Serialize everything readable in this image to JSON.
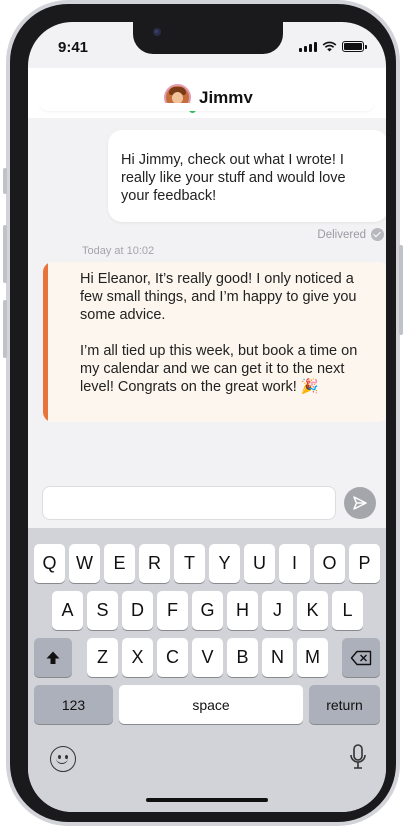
{
  "status_bar": {
    "time": "9:41"
  },
  "header": {
    "contact_name": "Jimmy"
  },
  "messages": {
    "outgoing": {
      "text": "Hi Jimmy, check out what I wrote! I really like your stuff and would love your feedback!",
      "status": "Delivered"
    },
    "timestamp": "Today at 10:02",
    "incoming": {
      "paragraph_1": "Hi Eleanor, It’s really good! I only noticed a few small things, and I’m happy to give you some advice.",
      "paragraph_2": "I’m all tied up this week, but book a time on my calendar and we can get it to the next level! Congrats on the great work! 🎉"
    }
  },
  "composer": {
    "value": "",
    "send_icon": "send-icon"
  },
  "keyboard": {
    "row1": [
      "Q",
      "W",
      "E",
      "R",
      "T",
      "Y",
      "U",
      "I",
      "O",
      "P"
    ],
    "row2": [
      "A",
      "S",
      "D",
      "F",
      "G",
      "H",
      "J",
      "K",
      "L"
    ],
    "row3": [
      "Z",
      "X",
      "C",
      "V",
      "B",
      "N",
      "M"
    ],
    "numbers_label": "123",
    "space_label": "space",
    "return_label": "return",
    "shift_icon": "shift-icon",
    "delete_icon": "backspace-icon",
    "emoji_icon": "emoji-icon",
    "mic_icon": "microphone-icon"
  },
  "colors": {
    "accent_bar": "#e8743c",
    "incoming_bubble": "#fdf6ee",
    "online_dot": "#31c45b"
  }
}
